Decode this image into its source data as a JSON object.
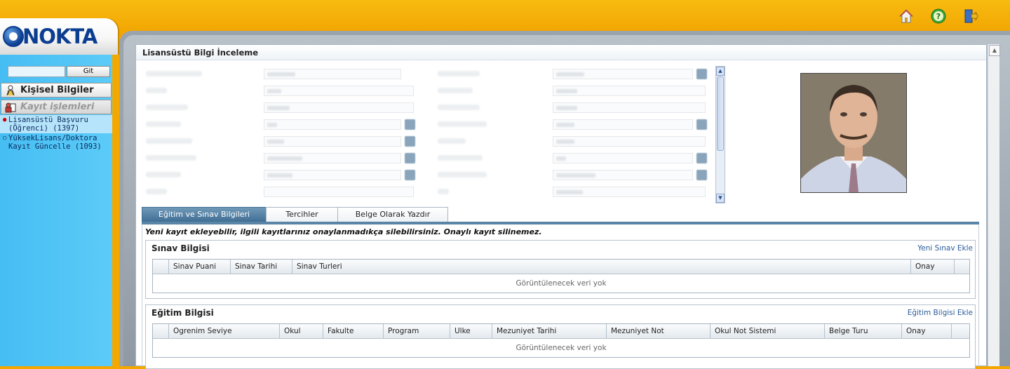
{
  "app": {
    "logo_text": "NOKTA"
  },
  "top_icons": [
    "home-icon",
    "help-icon",
    "exit-icon"
  ],
  "sidebar": {
    "search": {
      "value": "",
      "placeholder": ""
    },
    "go_label": "Git",
    "menus": [
      {
        "label": "Kişisel Bilgiler",
        "icon": "person-icon",
        "enabled": true
      },
      {
        "label": "Kayıt işlemleri",
        "icon": "registration-icon",
        "enabled": false
      }
    ],
    "items": [
      {
        "label": "Lisansüstü Başvuru (Öğrenci) (1397)",
        "active": true
      },
      {
        "label": "YüksekLisans/Doktora Kayıt Güncelle (1093)",
        "active": false
      }
    ]
  },
  "panel": {
    "title": "Lisansüstü Bilgi İnceleme"
  },
  "tabs": [
    {
      "label": "Eğitim ve Sınav Bilgileri",
      "active": true
    },
    {
      "label": "Tercihler",
      "active": false
    },
    {
      "label": "Belge Olarak Yazdır",
      "active": false
    }
  ],
  "notice": "Yeni kayıt ekleyebilir, ilgili kayıtlarınız onaylanmadıkça silebilirsiniz. Onaylı kayıt silinemez.",
  "exam_section": {
    "title": "Sınav Bilgisi",
    "add_link": "Yeni Sınav Ekle",
    "columns": [
      "",
      "Sinav Puani",
      "Sinav Tarihi",
      "Sinav Turleri",
      "Onay",
      ""
    ],
    "empty_text": "Görüntülenecek veri yok"
  },
  "education_section": {
    "title": "Eğitim Bilgisi",
    "add_link": "Eğitim Bilgisi Ekle",
    "columns": [
      "",
      "Ogrenim Seviye",
      "Okul",
      "Fakulte",
      "Program",
      "Ulke",
      "Mezuniyet Tarihi",
      "Mezuniyet Not",
      "Okul Not Sistemi",
      "Belge Turu",
      "Onay",
      ""
    ],
    "empty_text": "Görüntülenecek veri yok"
  }
}
